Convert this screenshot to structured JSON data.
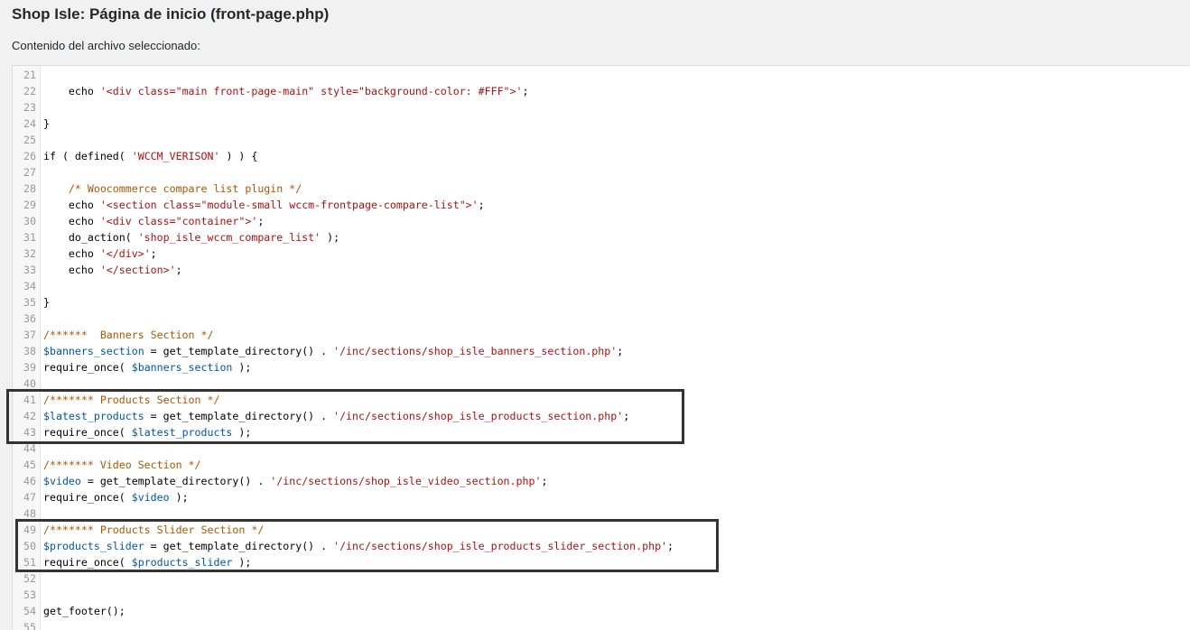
{
  "header": {
    "title": "Shop Isle: Página de inicio (front-page.php)",
    "file_label": "Contenido del archivo seleccionado:"
  },
  "editor": {
    "lines": [
      {
        "num": "21",
        "segments": []
      },
      {
        "num": "22",
        "segments": [
          {
            "type": "plain",
            "text": "    echo "
          },
          {
            "type": "str",
            "text": "'<div class=\"main front-page-main\" style=\"background-color: #FFF\">'"
          },
          {
            "type": "plain",
            "text": ";"
          }
        ]
      },
      {
        "num": "23",
        "segments": []
      },
      {
        "num": "24",
        "segments": [
          {
            "type": "plain",
            "text": "}"
          }
        ]
      },
      {
        "num": "25",
        "segments": []
      },
      {
        "num": "26",
        "segments": [
          {
            "type": "plain",
            "text": "if ( defined( "
          },
          {
            "type": "str",
            "text": "'WCCM_VERISON'"
          },
          {
            "type": "plain",
            "text": " ) ) {"
          }
        ]
      },
      {
        "num": "27",
        "segments": []
      },
      {
        "num": "28",
        "segments": [
          {
            "type": "plain",
            "text": "    "
          },
          {
            "type": "com",
            "text": "/* Woocommerce compare list plugin */"
          }
        ]
      },
      {
        "num": "29",
        "segments": [
          {
            "type": "plain",
            "text": "    echo "
          },
          {
            "type": "str",
            "text": "'<section class=\"module-small wccm-frontpage-compare-list\">'"
          },
          {
            "type": "plain",
            "text": ";"
          }
        ]
      },
      {
        "num": "30",
        "segments": [
          {
            "type": "plain",
            "text": "    echo "
          },
          {
            "type": "str",
            "text": "'<div class=\"container\">'"
          },
          {
            "type": "plain",
            "text": ";"
          }
        ]
      },
      {
        "num": "31",
        "segments": [
          {
            "type": "plain",
            "text": "    do_action( "
          },
          {
            "type": "str",
            "text": "'shop_isle_wccm_compare_list'"
          },
          {
            "type": "plain",
            "text": " );"
          }
        ]
      },
      {
        "num": "32",
        "segments": [
          {
            "type": "plain",
            "text": "    echo "
          },
          {
            "type": "str",
            "text": "'</div>'"
          },
          {
            "type": "plain",
            "text": ";"
          }
        ]
      },
      {
        "num": "33",
        "segments": [
          {
            "type": "plain",
            "text": "    echo "
          },
          {
            "type": "str",
            "text": "'</section>'"
          },
          {
            "type": "plain",
            "text": ";"
          }
        ]
      },
      {
        "num": "34",
        "segments": []
      },
      {
        "num": "35",
        "segments": [
          {
            "type": "plain",
            "text": "}"
          }
        ]
      },
      {
        "num": "36",
        "segments": []
      },
      {
        "num": "37",
        "segments": [
          {
            "type": "com",
            "text": "/******  Banners Section */"
          }
        ]
      },
      {
        "num": "38",
        "segments": [
          {
            "type": "var",
            "text": "$banners_section"
          },
          {
            "type": "plain",
            "text": " = get_template_directory() . "
          },
          {
            "type": "str",
            "text": "'/inc/sections/shop_isle_banners_section.php'"
          },
          {
            "type": "plain",
            "text": ";"
          }
        ]
      },
      {
        "num": "39",
        "segments": [
          {
            "type": "plain",
            "text": "require_once( "
          },
          {
            "type": "var",
            "text": "$banners_section"
          },
          {
            "type": "plain",
            "text": " );"
          }
        ]
      },
      {
        "num": "40",
        "segments": []
      },
      {
        "num": "41",
        "segments": [
          {
            "type": "com",
            "text": "/******* Products Section */"
          }
        ]
      },
      {
        "num": "42",
        "segments": [
          {
            "type": "var",
            "text": "$latest_products"
          },
          {
            "type": "plain",
            "text": " = get_template_directory() . "
          },
          {
            "type": "str",
            "text": "'/inc/sections/shop_isle_products_section.php'"
          },
          {
            "type": "plain",
            "text": ";"
          }
        ]
      },
      {
        "num": "43",
        "segments": [
          {
            "type": "plain",
            "text": "require_once( "
          },
          {
            "type": "var",
            "text": "$latest_products"
          },
          {
            "type": "plain",
            "text": " );"
          }
        ]
      },
      {
        "num": "44",
        "segments": []
      },
      {
        "num": "45",
        "segments": [
          {
            "type": "com",
            "text": "/******* Video Section */"
          }
        ]
      },
      {
        "num": "46",
        "segments": [
          {
            "type": "var",
            "text": "$video"
          },
          {
            "type": "plain",
            "text": " = get_template_directory() . "
          },
          {
            "type": "str",
            "text": "'/inc/sections/shop_isle_video_section.php'"
          },
          {
            "type": "plain",
            "text": ";"
          }
        ]
      },
      {
        "num": "47",
        "segments": [
          {
            "type": "plain",
            "text": "require_once( "
          },
          {
            "type": "var",
            "text": "$video"
          },
          {
            "type": "plain",
            "text": " );"
          }
        ]
      },
      {
        "num": "48",
        "segments": []
      },
      {
        "num": "49",
        "segments": [
          {
            "type": "com",
            "text": "/******* Products Slider Section */"
          }
        ]
      },
      {
        "num": "50",
        "segments": [
          {
            "type": "var",
            "text": "$products_slider"
          },
          {
            "type": "plain",
            "text": " = get_template_directory() . "
          },
          {
            "type": "str",
            "text": "'/inc/sections/shop_isle_products_slider_section.php'"
          },
          {
            "type": "plain",
            "text": ";"
          }
        ]
      },
      {
        "num": "51",
        "segments": [
          {
            "type": "plain",
            "text": "require_once( "
          },
          {
            "type": "var",
            "text": "$products_slider"
          },
          {
            "type": "plain",
            "text": " );"
          }
        ]
      },
      {
        "num": "52",
        "segments": []
      },
      {
        "num": "53",
        "segments": []
      },
      {
        "num": "54",
        "segments": [
          {
            "type": "plain",
            "text": "get_footer();"
          }
        ]
      },
      {
        "num": "55",
        "segments": []
      }
    ]
  },
  "colors": {
    "string": "#aa1111",
    "comment": "#aa5500",
    "variable": "#0055aa",
    "line_number": "#999999",
    "highlight_border": "#333333"
  }
}
